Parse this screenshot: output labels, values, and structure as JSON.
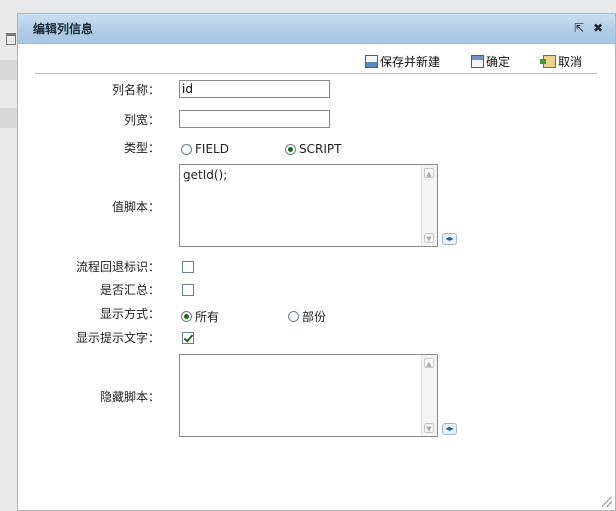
{
  "dialog": {
    "title": "编辑列信息",
    "popout_glyph": "⇱",
    "close_glyph": "✖"
  },
  "toolbar": {
    "save_new_label": "保存并新建",
    "ok_label": "确定",
    "cancel_label": "取消"
  },
  "form": {
    "column_name": {
      "label": "列名称：",
      "value": "id"
    },
    "column_width": {
      "label": "列宽：",
      "value": ""
    },
    "type": {
      "label": "类型：",
      "options": [
        "FIELD",
        "SCRIPT"
      ],
      "selected": "SCRIPT"
    },
    "value_script": {
      "label": "值脚本：",
      "value": "getId();"
    },
    "flow_rollback": {
      "label": "流程回退标识：",
      "checked": false
    },
    "summary": {
      "label": "是否汇总：",
      "checked": false
    },
    "display_mode": {
      "label": "显示方式：",
      "options": [
        "所有",
        "部份"
      ],
      "selected": "所有"
    },
    "show_tip_text": {
      "label": "显示提示文字：",
      "checked": true
    },
    "hidden_script": {
      "label": "隐藏脚本：",
      "value": ""
    }
  },
  "icons": {
    "scroll_up": "▲",
    "scroll_down": "▼",
    "expand": "◂▸"
  }
}
